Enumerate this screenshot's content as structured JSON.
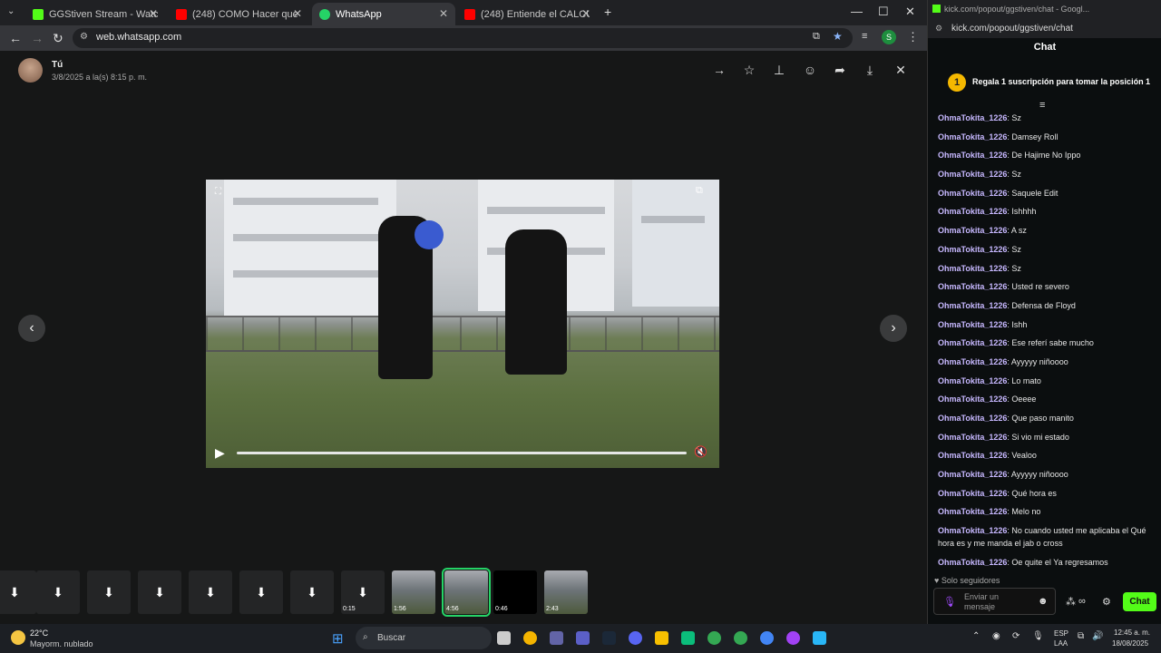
{
  "browser": {
    "tabs": [
      {
        "label": "GGStiven Stream - Watch Live o",
        "color": "#53fc18"
      },
      {
        "label": "(248) COMO Hacer que Tu Opo",
        "color": "#ff0000"
      },
      {
        "label": "WhatsApp",
        "color": "#25d366"
      },
      {
        "label": "(248) Entiende el CALCULADO c",
        "color": "#ff0000"
      }
    ],
    "url": "web.whatsapp.com",
    "profile_initial": "S"
  },
  "viewer": {
    "sender": "Tú",
    "date": "3/8/2025 a la(s) 8:15 p. m.",
    "strip": {
      "durations": [
        "0:15",
        "1:56",
        "4:56",
        "0:46",
        "2:43"
      ]
    }
  },
  "chat_window": {
    "title_bar": "kick.com/popout/ggstiven/chat - Googl...",
    "url": "kick.com/popout/ggstiven/chat",
    "chat_title": "Chat",
    "banner_badge": "1",
    "banner_text": "Regala 1 suscripción para tomar la posición 1",
    "accent": "#53fc18",
    "messages": [
      {
        "user": "OhmaTokita_1226",
        "text": "Sz"
      },
      {
        "user": "OhmaTokita_1226",
        "text": "Damsey Roll"
      },
      {
        "user": "OhmaTokita_1226",
        "text": "De Hajime No Ippo"
      },
      {
        "user": "OhmaTokita_1226",
        "text": "Sz"
      },
      {
        "user": "OhmaTokita_1226",
        "text": "Saquele Edit"
      },
      {
        "user": "OhmaTokita_1226",
        "text": "Ishhhh"
      },
      {
        "user": "OhmaTokita_1226",
        "text": "A sz"
      },
      {
        "user": "OhmaTokita_1226",
        "text": "Sz"
      },
      {
        "user": "OhmaTokita_1226",
        "text": "Sz"
      },
      {
        "user": "OhmaTokita_1226",
        "text": "Usted re severo"
      },
      {
        "user": "OhmaTokita_1226",
        "text": "Defensa de Floyd"
      },
      {
        "user": "OhmaTokita_1226",
        "text": "Ishh"
      },
      {
        "user": "OhmaTokita_1226",
        "text": "Ese referí sabe mucho"
      },
      {
        "user": "OhmaTokita_1226",
        "text": "Ayyyyy niñoooo"
      },
      {
        "user": "OhmaTokita_1226",
        "text": "Lo mato"
      },
      {
        "user": "OhmaTokita_1226",
        "text": "Oeeee"
      },
      {
        "user": "OhmaTokita_1226",
        "text": "Que paso manito"
      },
      {
        "user": "OhmaTokita_1226",
        "text": "Si vio mi estado"
      },
      {
        "user": "OhmaTokita_1226",
        "text": "Vealoo"
      },
      {
        "user": "OhmaTokita_1226",
        "text": "Ayyyyy niñoooo"
      },
      {
        "user": "OhmaTokita_1226",
        "text": "Qué hora es"
      },
      {
        "user": "OhmaTokita_1226",
        "text": "Melo no"
      },
      {
        "user": "OhmaTokita_1226",
        "text": "No cuando usted me aplicaba el Qué hora es y me manda el jab o cross"
      },
      {
        "user": "OhmaTokita_1226",
        "text": "Oe quite el Ya regresamos"
      }
    ],
    "followers_only": "Solo seguidores",
    "input_placeholder": "Enviar un mensaje",
    "send_label": "Chat"
  },
  "taskbar": {
    "temperature": "22°C",
    "weather": "Mayorm. nublado",
    "search_label": "Buscar",
    "lang1": "ESP",
    "lang2": "LAA",
    "time": "12:45 a. m.",
    "date": "18/08/2025"
  }
}
